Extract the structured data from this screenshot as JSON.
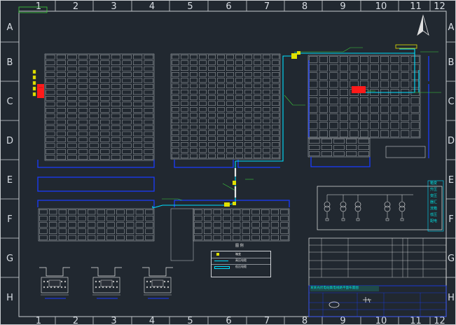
{
  "ruler": {
    "columns": [
      "1",
      "2",
      "3",
      "4",
      "5",
      "6",
      "7",
      "8",
      "9",
      "10",
      "11",
      "12"
    ],
    "rows": [
      "A",
      "B",
      "C",
      "D",
      "E",
      "F",
      "G",
      "H"
    ]
  },
  "legend": {
    "title": "图 例",
    "items": [
      "箱变",
      "高压电缆",
      "低压电缆"
    ]
  },
  "single_line": {
    "notes": [
      "箱变",
      "升压",
      "变压",
      "器汇",
      "流箱",
      "低压",
      "配电"
    ]
  },
  "title_block": {
    "banner": "某某光伏电站集电线路平面布置图"
  },
  "colors": {
    "background": "#212830",
    "frame": "#d0d4d8",
    "panel": "#c8ccd0",
    "hv_cable": "#00e0ff",
    "lv_cable": "#1a3cff",
    "leader": "#3cd23c",
    "transformer": "#e0e000",
    "combiner": "#ff1a1a"
  }
}
